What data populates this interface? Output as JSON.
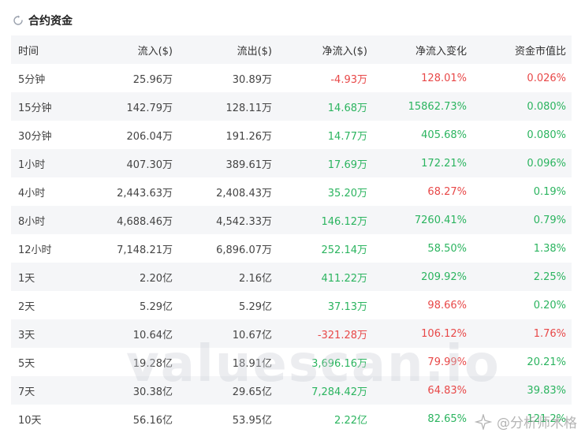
{
  "title": "合约资金",
  "watermark": "valuescan.io",
  "corner_mark": "@分析师木格",
  "colors": {
    "positive": "#2bb45f",
    "negative": "#e84848",
    "row_shade": "#f5f6f8"
  },
  "headers": [
    "时间",
    "流入($)",
    "流出($)",
    "净流入($)",
    "净流入变化",
    "资金市值比"
  ],
  "rows": [
    {
      "time": "5分钟",
      "inflow": "25.96万",
      "outflow": "30.89万",
      "net": "-4.93万",
      "net_dir": "neg",
      "change": "128.01%",
      "change_dir": "neg",
      "ratio": "0.026%",
      "ratio_dir": "neg"
    },
    {
      "time": "15分钟",
      "inflow": "142.79万",
      "outflow": "128.11万",
      "net": "14.68万",
      "net_dir": "pos",
      "change": "15862.73%",
      "change_dir": "pos",
      "ratio": "0.080%",
      "ratio_dir": "pos"
    },
    {
      "time": "30分钟",
      "inflow": "206.04万",
      "outflow": "191.26万",
      "net": "14.77万",
      "net_dir": "pos",
      "change": "405.68%",
      "change_dir": "pos",
      "ratio": "0.080%",
      "ratio_dir": "pos"
    },
    {
      "time": "1小时",
      "inflow": "407.30万",
      "outflow": "389.61万",
      "net": "17.69万",
      "net_dir": "pos",
      "change": "172.21%",
      "change_dir": "pos",
      "ratio": "0.096%",
      "ratio_dir": "pos"
    },
    {
      "time": "4小时",
      "inflow": "2,443.63万",
      "outflow": "2,408.43万",
      "net": "35.20万",
      "net_dir": "pos",
      "change": "68.27%",
      "change_dir": "neg",
      "ratio": "0.19%",
      "ratio_dir": "pos"
    },
    {
      "time": "8小时",
      "inflow": "4,688.46万",
      "outflow": "4,542.33万",
      "net": "146.12万",
      "net_dir": "pos",
      "change": "7260.41%",
      "change_dir": "pos",
      "ratio": "0.79%",
      "ratio_dir": "pos"
    },
    {
      "time": "12小时",
      "inflow": "7,148.21万",
      "outflow": "6,896.07万",
      "net": "252.14万",
      "net_dir": "pos",
      "change": "58.50%",
      "change_dir": "pos",
      "ratio": "1.38%",
      "ratio_dir": "pos"
    },
    {
      "time": "1天",
      "inflow": "2.20亿",
      "outflow": "2.16亿",
      "net": "411.22万",
      "net_dir": "pos",
      "change": "209.92%",
      "change_dir": "pos",
      "ratio": "2.25%",
      "ratio_dir": "pos"
    },
    {
      "time": "2天",
      "inflow": "5.29亿",
      "outflow": "5.29亿",
      "net": "37.13万",
      "net_dir": "pos",
      "change": "98.66%",
      "change_dir": "neg",
      "ratio": "0.20%",
      "ratio_dir": "pos"
    },
    {
      "time": "3天",
      "inflow": "10.64亿",
      "outflow": "10.67亿",
      "net": "-321.28万",
      "net_dir": "neg",
      "change": "106.12%",
      "change_dir": "neg",
      "ratio": "1.76%",
      "ratio_dir": "neg"
    },
    {
      "time": "5天",
      "inflow": "19.28亿",
      "outflow": "18.91亿",
      "net": "3,696.16万",
      "net_dir": "pos",
      "change": "79.99%",
      "change_dir": "neg",
      "ratio": "20.21%",
      "ratio_dir": "pos"
    },
    {
      "time": "7天",
      "inflow": "30.38亿",
      "outflow": "29.65亿",
      "net": "7,284.42万",
      "net_dir": "pos",
      "change": "64.83%",
      "change_dir": "neg",
      "ratio": "39.83%",
      "ratio_dir": "pos"
    },
    {
      "time": "10天",
      "inflow": "56.16亿",
      "outflow": "53.95亿",
      "net": "2.22亿",
      "net_dir": "pos",
      "change": "82.65%",
      "change_dir": "pos",
      "ratio": "121.2%",
      "ratio_dir": "pos"
    }
  ]
}
